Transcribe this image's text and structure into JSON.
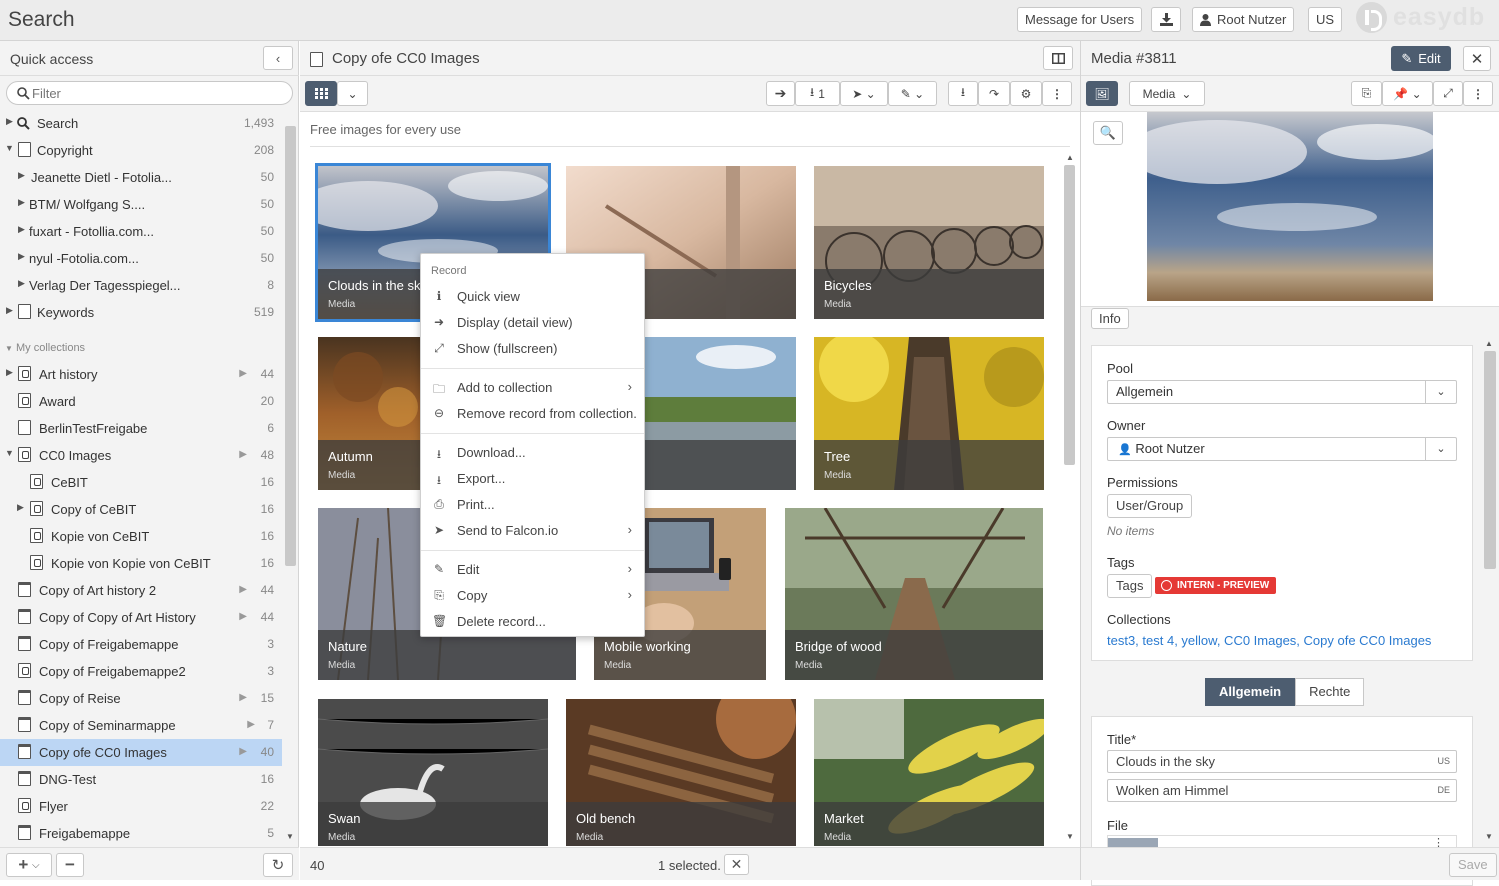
{
  "app": {
    "title": "Search"
  },
  "topbar": {
    "message_label": "Message for Users",
    "user_label": "Root Nutzer",
    "lang_label": "US",
    "logo_text": "easydb"
  },
  "sidebar": {
    "header": "Quick access",
    "filter_placeholder": "Filter",
    "section_label": "My collections",
    "rows": [
      {
        "label": "Search",
        "count": "1,493"
      },
      {
        "label": "Copyright",
        "count": "208"
      },
      {
        "label": "Jeanette Dietl - Fotolia...",
        "count": "50"
      },
      {
        "label": "BTM/ Wolfgang S....",
        "count": "50"
      },
      {
        "label": "fuxart - Fotollia.com...",
        "count": "50"
      },
      {
        "label": "nyul -Fotolia.com...",
        "count": "50"
      },
      {
        "label": "Verlag Der Tagesspiegel...",
        "count": "8"
      },
      {
        "label": "Keywords",
        "count": "519"
      }
    ],
    "collections": [
      {
        "label": "Art history",
        "count": "44"
      },
      {
        "label": "Award",
        "count": "20"
      },
      {
        "label": "BerlinTestFreigabe",
        "count": "6"
      },
      {
        "label": "CC0 Images",
        "count": "48"
      },
      {
        "label": "CeBIT",
        "count": "16"
      },
      {
        "label": "Copy of CeBIT",
        "count": "16"
      },
      {
        "label": "Kopie von CeBIT",
        "count": "16"
      },
      {
        "label": "Kopie von Kopie von CeBIT",
        "count": "16"
      },
      {
        "label": "Copy of Art history 2",
        "count": "44"
      },
      {
        "label": "Copy of Copy of Art History",
        "count": "44"
      },
      {
        "label": "Copy of Freigabemappe",
        "count": "3"
      },
      {
        "label": "Copy of Freigabemappe2",
        "count": "3"
      },
      {
        "label": "Copy of Reise",
        "count": "15"
      },
      {
        "label": "Copy of Seminarmappe",
        "count": "7"
      },
      {
        "label": "Copy ofe CC0 Images",
        "count": "40"
      },
      {
        "label": "DNG-Test",
        "count": "16"
      },
      {
        "label": "Flyer",
        "count": "22"
      },
      {
        "label": "Freigabemappe",
        "count": "5"
      }
    ]
  },
  "main": {
    "title": "Copy ofe CC0 Images",
    "description": "Free images for every use",
    "download_count": "1",
    "footer_count": "40",
    "footer_selected": "1 selected.",
    "cards": [
      {
        "name": "Clouds in the sky",
        "type": "Media"
      },
      {
        "name": "",
        "type": ""
      },
      {
        "name": "Bicycles",
        "type": "Media"
      },
      {
        "name": "Autumn",
        "type": "Media"
      },
      {
        "name": "",
        "type": ""
      },
      {
        "name": "Tree",
        "type": "Media"
      },
      {
        "name": "Nature",
        "type": "Media"
      },
      {
        "name": "Mobile working",
        "type": "Media"
      },
      {
        "name": "Bridge of wood",
        "type": "Media"
      },
      {
        "name": "Swan",
        "type": "Media"
      },
      {
        "name": "Old bench",
        "type": "Media"
      },
      {
        "name": "Market",
        "type": "Media"
      }
    ]
  },
  "context_menu": {
    "header": "Record",
    "items": [
      {
        "label": "Quick view"
      },
      {
        "label": "Display (detail view)"
      },
      {
        "label": "Show (fullscreen)"
      },
      {
        "label": "Add to collection"
      },
      {
        "label": "Remove record from collection."
      },
      {
        "label": "Download..."
      },
      {
        "label": "Export..."
      },
      {
        "label": "Print..."
      },
      {
        "label": "Send to Falcon.io"
      },
      {
        "label": "Edit"
      },
      {
        "label": "Copy"
      },
      {
        "label": "Delete record..."
      }
    ]
  },
  "detail": {
    "title": "Media #3811",
    "edit_label": "Edit",
    "mask_select": "Media",
    "info_label": "Info",
    "pool_label": "Pool",
    "pool_value": "Allgemein",
    "owner_label": "Owner",
    "owner_value": "Root Nutzer",
    "permissions_label": "Permissions",
    "permissions_btn": "User/Group",
    "no_items": "No items",
    "tags_label": "Tags",
    "tags_btn": "Tags",
    "tag_badge": "INTERN - PREVIEW",
    "collections_label": "Collections",
    "collections_value": "test3, test 4, yellow, CC0 Images, Copy ofe CC0 Images",
    "tab_general": "Allgemein",
    "tab_rights": "Rechte",
    "title_field_label": "Title*",
    "title_en": "Clouds in the sky",
    "title_en_lang": "US",
    "title_de": "Wolken am Himmel",
    "title_de_lang": "DE",
    "file_label": "File",
    "save_label": "Save"
  },
  "colors": {
    "accent": "#3a86d6",
    "selection": "#bcd6f4",
    "dark_button": "#4d5d70",
    "tag_red": "#e53935"
  }
}
